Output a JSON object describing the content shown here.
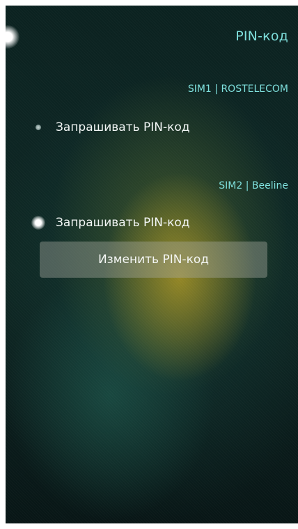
{
  "screen": {
    "title": "PIN-код",
    "accent_color": "#7fe0dd"
  },
  "sim1": {
    "header": "SIM1 | ROSTELECOM",
    "request_pin": {
      "label": "Запрашивать PIN-код",
      "enabled": false
    }
  },
  "sim2": {
    "header": "SIM2 | Beeline",
    "request_pin": {
      "label": "Запрашивать PIN-код",
      "enabled": true
    },
    "change_pin_button": "Изменить PIN-код"
  }
}
